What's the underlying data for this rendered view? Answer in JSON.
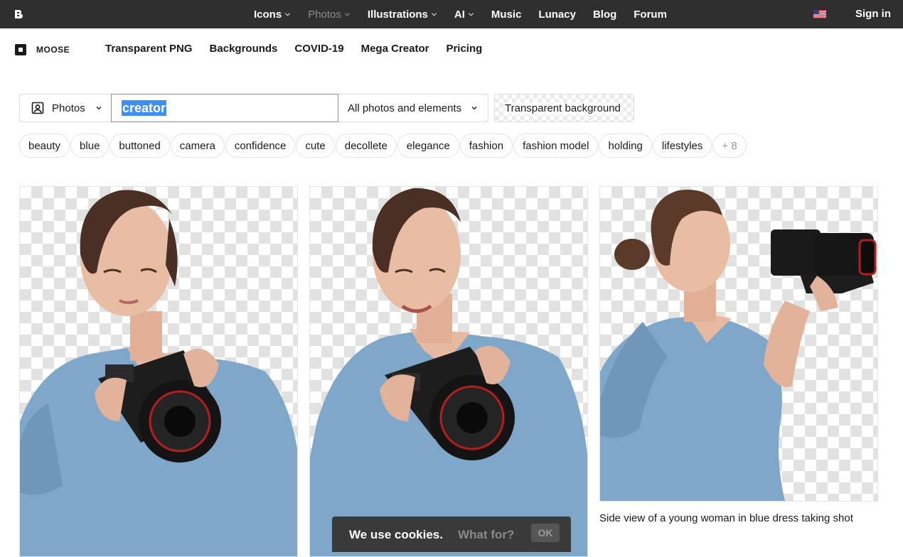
{
  "topbar": {
    "nav": [
      {
        "label": "Icons",
        "dropdown": true,
        "muted": false
      },
      {
        "label": "Photos",
        "dropdown": true,
        "muted": true
      },
      {
        "label": "Illustrations",
        "dropdown": true,
        "muted": false
      },
      {
        "label": "AI",
        "dropdown": true,
        "muted": false
      },
      {
        "label": "Music",
        "dropdown": false,
        "muted": false
      },
      {
        "label": "Lunacy",
        "dropdown": false,
        "muted": false
      },
      {
        "label": "Blog",
        "dropdown": false,
        "muted": false
      },
      {
        "label": "Forum",
        "dropdown": false,
        "muted": false
      }
    ],
    "signin": "Sign in",
    "flag_icon": "us-flag-icon"
  },
  "subheader": {
    "brand": "MOOSE",
    "links": [
      "Transparent PNG",
      "Backgrounds",
      "COVID-19",
      "Mega Creator",
      "Pricing"
    ]
  },
  "search": {
    "type_label": "Photos",
    "query": "creator",
    "filter_label": "All photos and elements",
    "transparent_label": "Transparent background"
  },
  "tags": [
    "beauty",
    "blue",
    "buttoned",
    "camera",
    "confidence",
    "cute",
    "decollete",
    "elegance",
    "fashion",
    "fashion model",
    "holding",
    "lifestyles"
  ],
  "tags_more": "+ 8",
  "results": {
    "caption_3": "Side view of a young woman in blue dress taking shot"
  },
  "cookie": {
    "text": "We use cookies.",
    "link": "What for?",
    "ok": "OK"
  },
  "colors": {
    "topbar": "#2f2f2f",
    "selection": "#3d8ff4",
    "dress": "#7fa7c9",
    "cookie_bg": "#3a3a3a"
  }
}
